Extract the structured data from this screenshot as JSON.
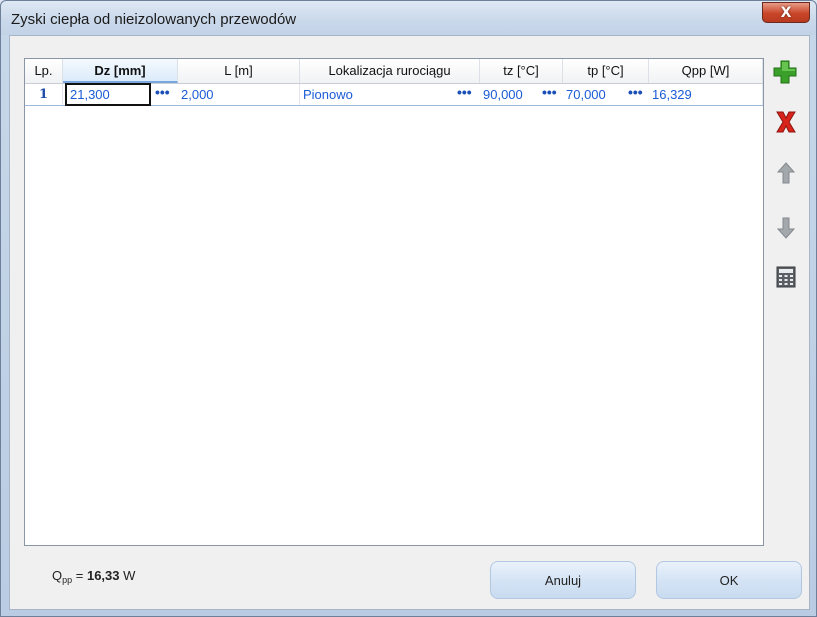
{
  "window": {
    "title": "Zyski ciepła od nieizolowanych przewodów",
    "close_label": "X"
  },
  "table": {
    "headers": [
      "Lp.",
      "Dz [mm]",
      "L [m]",
      "Lokalizacja rurociągu",
      "tz [°C]",
      "tp [°C]",
      "Qpp [W]"
    ],
    "rows": [
      {
        "lp": "1",
        "dz": "21,300",
        "l": "2,000",
        "lokalizacja": "Pionowo",
        "tz": "90,000",
        "tp": "70,000",
        "qpp": "16,329"
      }
    ],
    "ellipsis": "•••"
  },
  "toolbar": {
    "add_icon": "plus-icon",
    "delete_icon": "delete-icon",
    "up_icon": "arrow-up-icon",
    "down_icon": "arrow-down-icon",
    "calc_icon": "calculator-icon"
  },
  "summary": {
    "symbol": "Q",
    "subscript": "pp",
    "equals": " = ",
    "value": "16,33",
    "unit": "W"
  },
  "buttons": {
    "cancel": "Anuluj",
    "ok": "OK"
  },
  "colors": {
    "value_text": "#1b5bd6",
    "add_green": "#3aa02a",
    "delete_red": "#d8241a",
    "arrow_gray": "#9aa0a6"
  }
}
